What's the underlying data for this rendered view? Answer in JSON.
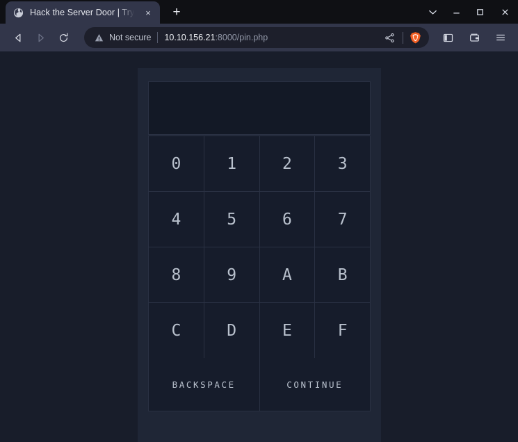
{
  "browser": {
    "tab": {
      "favicon": "globe-icon",
      "title": "Hack the Server Door | TryHackMe",
      "close_label": "×"
    },
    "new_tab_label": "+",
    "window_controls": {
      "tab_search": "tab-search-icon",
      "minimize": "minimize-icon",
      "maximize": "maximize-icon",
      "close": "close-icon"
    },
    "nav": {
      "back": "back-arrow-icon",
      "forward": "forward-arrow-icon",
      "reload": "reload-icon"
    },
    "omnibox": {
      "security_icon": "warning-triangle-icon",
      "security_label": "Not secure",
      "url_host": "10.10.156.21",
      "url_path": ":8000/pin.php",
      "url_full": "10.10.156.21:8000/pin.php",
      "share_icon": "share-icon",
      "shield_icon": "brave-shield-icon",
      "shield_color": "#f25f23"
    },
    "toolbar_buttons": [
      {
        "name": "sidebar-toggle",
        "icon": "sidebar-icon"
      },
      {
        "name": "wallet",
        "icon": "wallet-icon"
      },
      {
        "name": "main-menu",
        "icon": "hamburger-menu-icon"
      }
    ]
  },
  "page": {
    "display_value": "",
    "display_placeholder": "",
    "keys": [
      "0",
      "1",
      "2",
      "3",
      "4",
      "5",
      "6",
      "7",
      "8",
      "9",
      "A",
      "B",
      "C",
      "D",
      "E",
      "F"
    ],
    "actions": {
      "backspace": "BACKSPACE",
      "continue": "CONTINUE"
    },
    "colors": {
      "page_background": "#181d2a",
      "panel_background": "#1f2636",
      "key_background": "#161c2b",
      "display_background": "#131926",
      "border": "#2a3143",
      "text": "#b9c1cd"
    }
  }
}
